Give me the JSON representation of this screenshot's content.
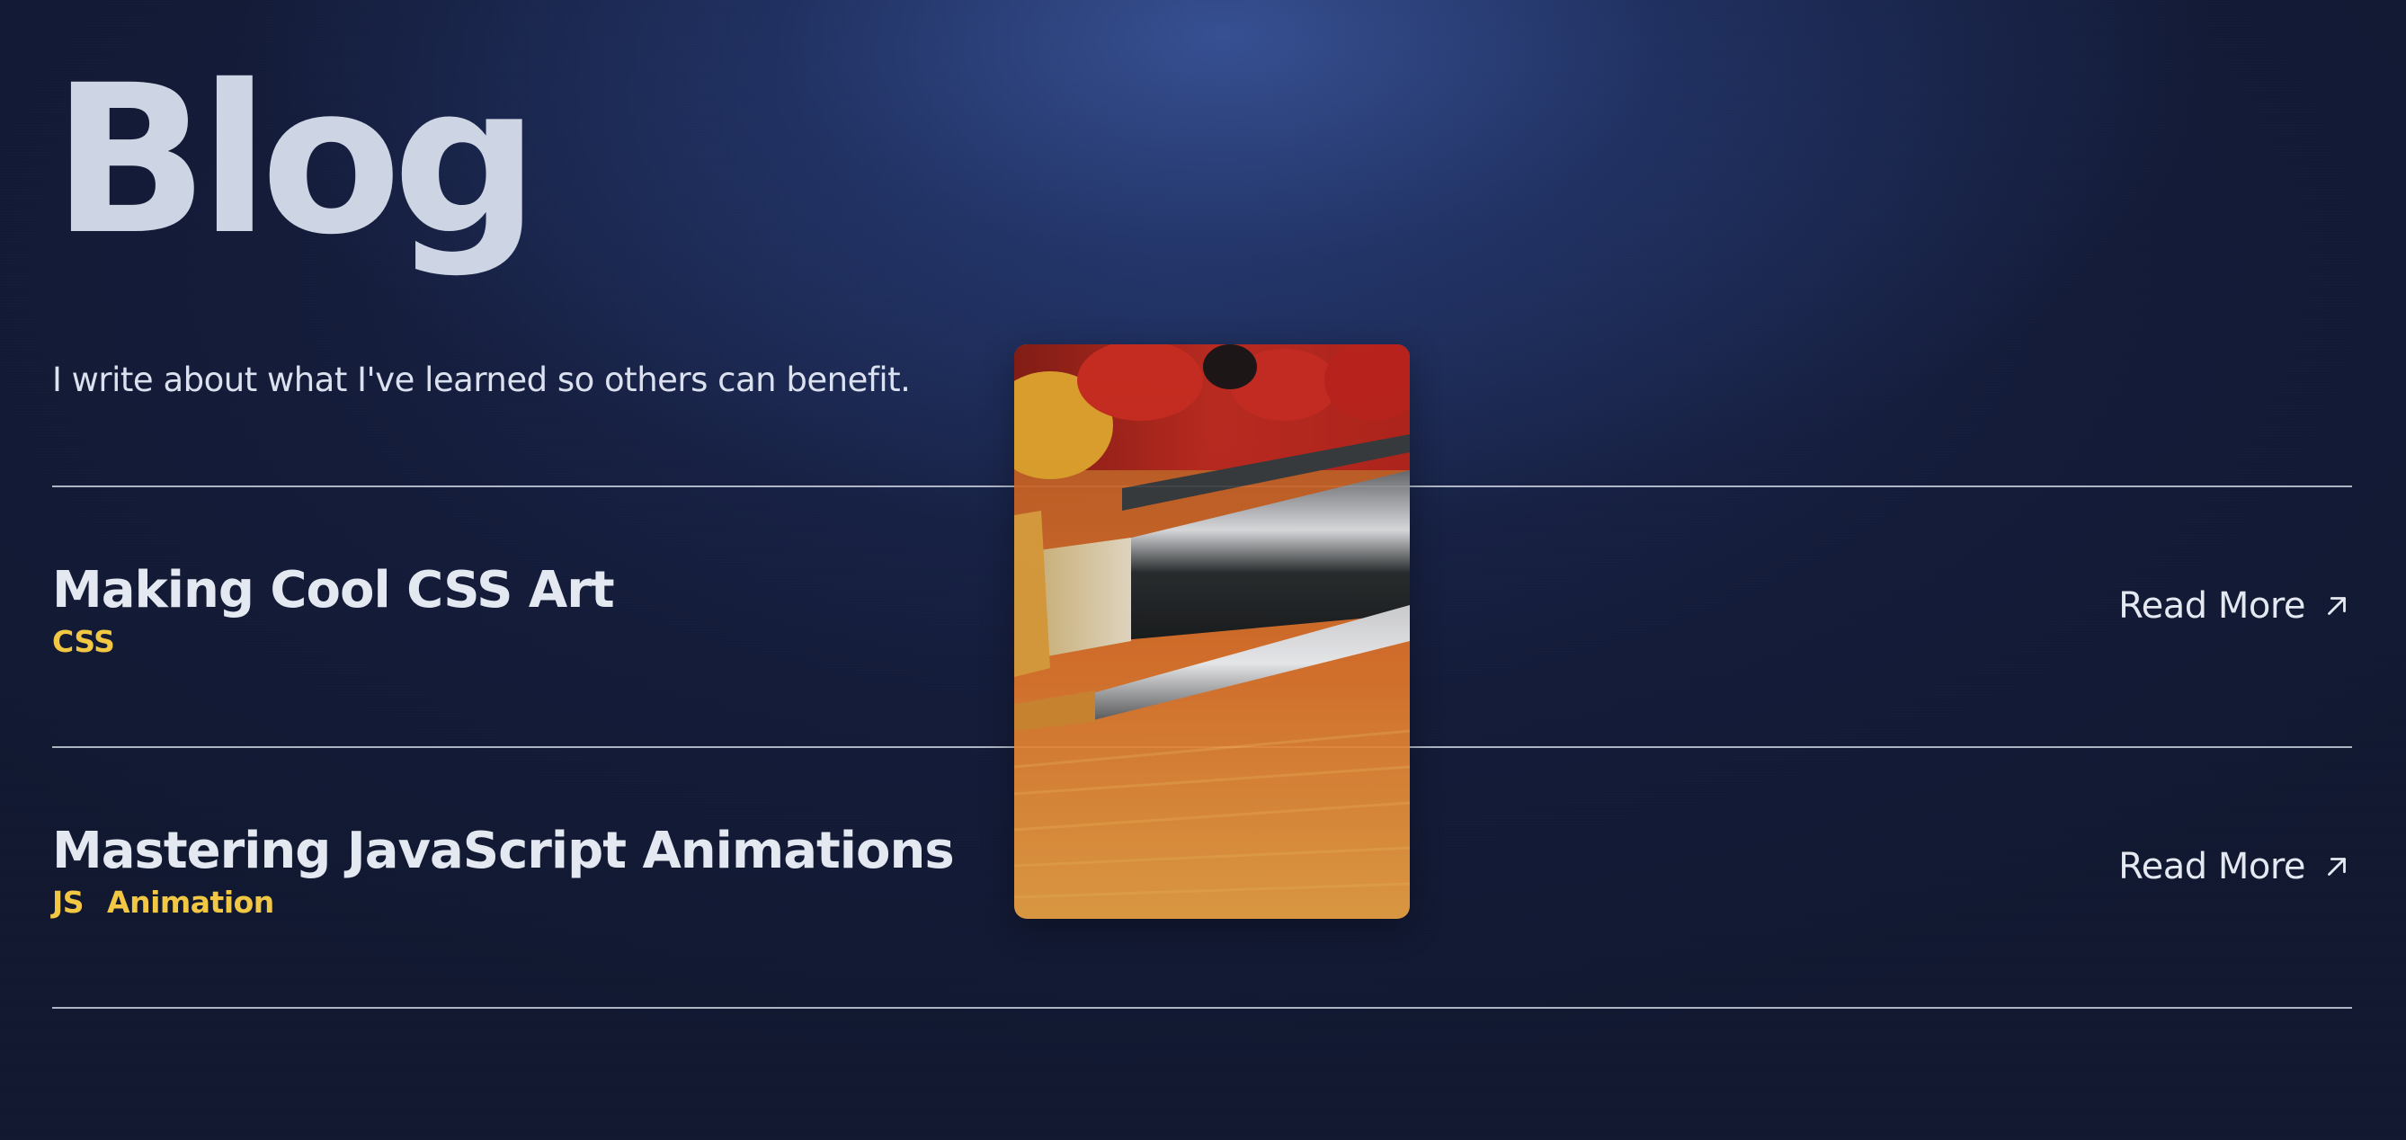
{
  "header": {
    "title": "Blog",
    "subtitle": "I write about what I've learned so others can benefit."
  },
  "posts": [
    {
      "title": "Making Cool CSS Art",
      "tags": [
        "CSS"
      ],
      "read_more_label": "Read More",
      "link_icon": "arrow-up-right-icon"
    },
    {
      "title": "Mastering JavaScript Animations",
      "tags": [
        "JS",
        "Animation"
      ],
      "read_more_label": "Read More",
      "link_icon": "arrow-up-right-icon"
    }
  ],
  "preview_image": {
    "subject": "paint brushes and oil paint on canvas"
  },
  "colors": {
    "background": "#141c3a",
    "accent_tag": "#f2c743",
    "text": "#e4e8f1",
    "title": "#cdd5e4",
    "divider": "#c9d0de"
  }
}
